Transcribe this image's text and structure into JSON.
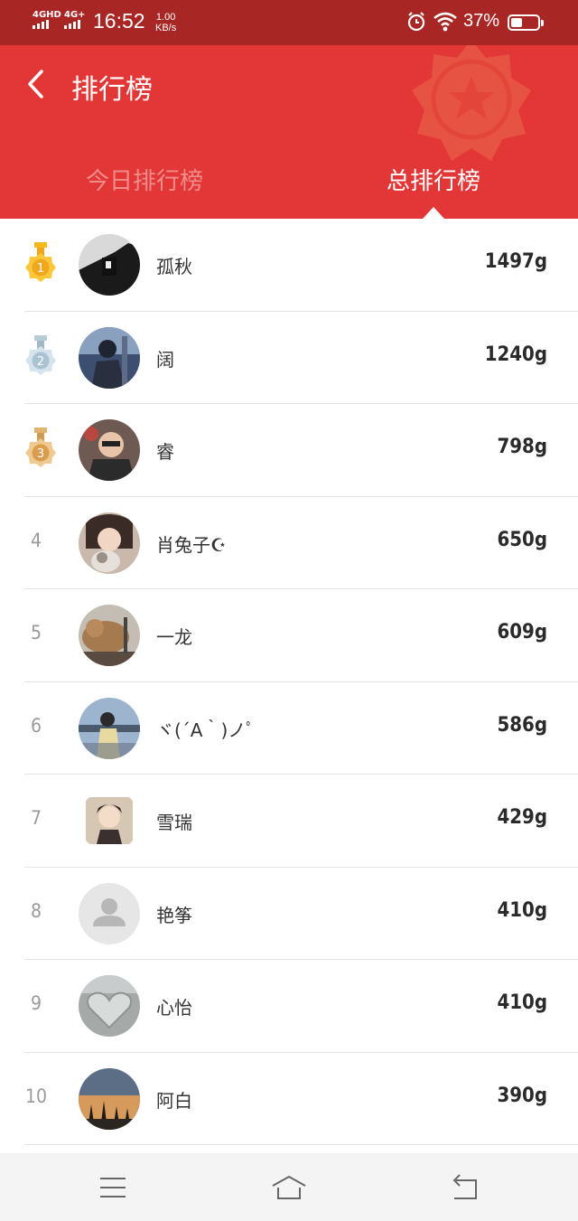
{
  "status": {
    "net1": "4GHD",
    "net2": "4G+",
    "time": "16:52",
    "speed_value": "1.00",
    "speed_unit": "KB/s",
    "battery": "37%"
  },
  "header": {
    "title": "排行榜",
    "tabs": [
      {
        "label": "今日排行榜",
        "active": false
      },
      {
        "label": "总排行榜",
        "active": true
      }
    ]
  },
  "colors": {
    "status_bar": "#a82624",
    "header": "#e33636",
    "gold": "#f5b91f",
    "silver": "#a9c3d3",
    "bronze": "#dba65e"
  },
  "ranking": [
    {
      "rank": "1",
      "medal": "gold-medal-icon",
      "name": "孤秋",
      "score": "1497g"
    },
    {
      "rank": "2",
      "medal": "silver-medal-icon",
      "name": "阔",
      "score": "1240g"
    },
    {
      "rank": "3",
      "medal": "bronze-medal-icon",
      "name": "睿",
      "score": "798g"
    },
    {
      "rank": "4",
      "name": "肖兔子☪",
      "score": "650g"
    },
    {
      "rank": "5",
      "name": "一龙",
      "score": "609g"
    },
    {
      "rank": "6",
      "name": "ヾ(´A｀)ノﾟ",
      "score": "586g"
    },
    {
      "rank": "7",
      "name": "雪瑞",
      "score": "429g"
    },
    {
      "rank": "8",
      "name": "艳筝",
      "score": "410g"
    },
    {
      "rank": "9",
      "name": "心怡",
      "score": "410g"
    },
    {
      "rank": "10",
      "name": "阿白",
      "score": "390g"
    }
  ],
  "navbar": {
    "icons": [
      "menu-icon",
      "home-icon",
      "back-icon"
    ]
  }
}
